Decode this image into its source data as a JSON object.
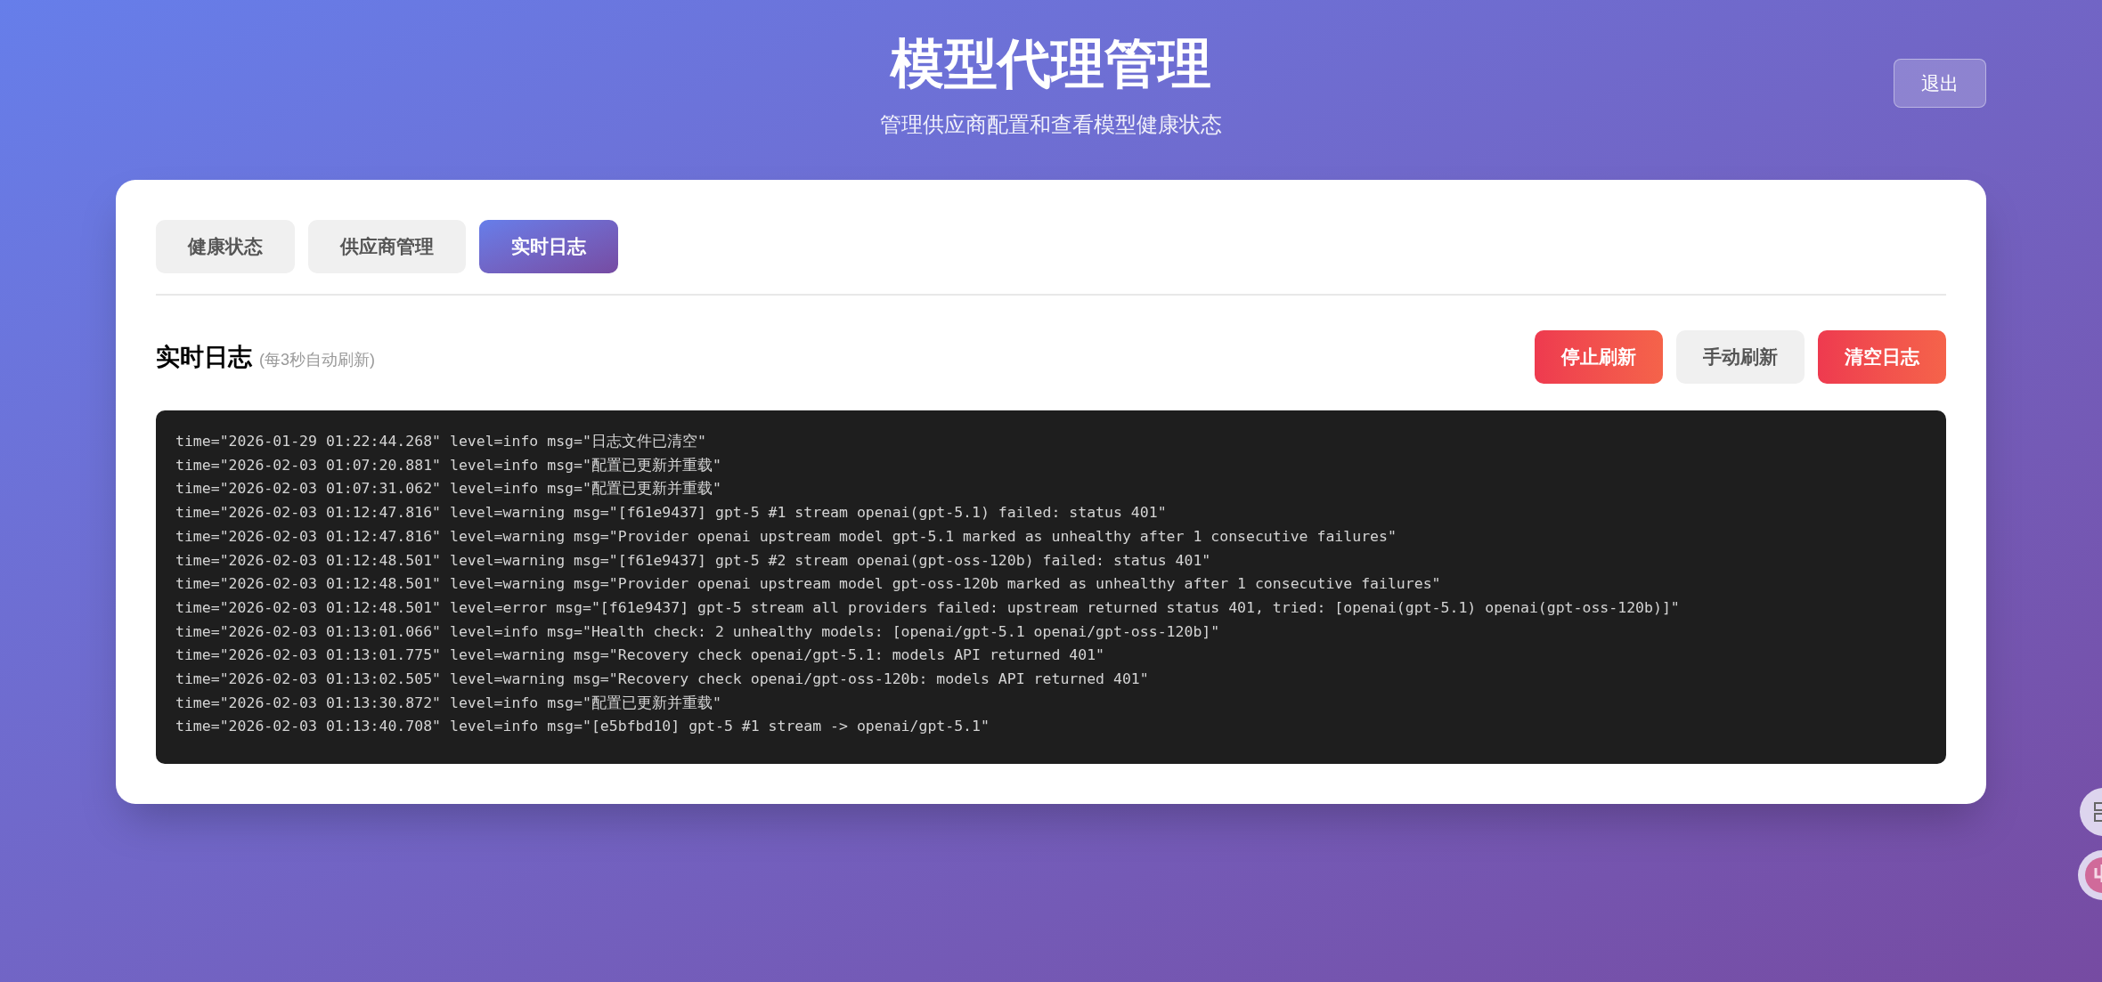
{
  "header": {
    "title": "模型代理管理",
    "subtitle": "管理供应商配置和查看模型健康状态",
    "logout": "退出"
  },
  "tabs": [
    {
      "label": "健康状态",
      "selected": false
    },
    {
      "label": "供应商管理",
      "selected": false
    },
    {
      "label": "实时日志",
      "selected": true
    }
  ],
  "log_panel": {
    "title": "实时日志",
    "note": "(每3秒自动刷新)",
    "buttons": [
      {
        "label": "停止刷新",
        "kind": "danger"
      },
      {
        "label": "手动刷新",
        "kind": "neutral"
      },
      {
        "label": "清空日志",
        "kind": "danger"
      }
    ],
    "lines": [
      "time=\"2026-01-29 01:22:44.268\" level=info msg=\"日志文件已清空\"",
      "time=\"2026-02-03 01:07:20.881\" level=info msg=\"配置已更新并重载\"",
      "time=\"2026-02-03 01:07:31.062\" level=info msg=\"配置已更新并重载\"",
      "time=\"2026-02-03 01:12:47.816\" level=warning msg=\"[f61e9437] gpt-5 #1 stream openai(gpt-5.1) failed: status 401\"",
      "time=\"2026-02-03 01:12:47.816\" level=warning msg=\"Provider openai upstream model gpt-5.1 marked as unhealthy after 1 consecutive failures\"",
      "time=\"2026-02-03 01:12:48.501\" level=warning msg=\"[f61e9437] gpt-5 #2 stream openai(gpt-oss-120b) failed: status 401\"",
      "time=\"2026-02-03 01:12:48.501\" level=warning msg=\"Provider openai upstream model gpt-oss-120b marked as unhealthy after 1 consecutive failures\"",
      "time=\"2026-02-03 01:12:48.501\" level=error msg=\"[f61e9437] gpt-5 stream all providers failed: upstream returned status 401, tried: [openai(gpt-5.1) openai(gpt-oss-120b)]\"",
      "time=\"2026-02-03 01:13:01.066\" level=info msg=\"Health check: 2 unhealthy models: [openai/gpt-5.1 openai/gpt-oss-120b]\"",
      "time=\"2026-02-03 01:13:01.775\" level=warning msg=\"Recovery check openai/gpt-5.1: models API returned 401\"",
      "time=\"2026-02-03 01:13:02.505\" level=warning msg=\"Recovery check openai/gpt-oss-120b: models API returned 401\"",
      "time=\"2026-02-03 01:13:30.872\" level=info msg=\"配置已更新并重载\"",
      "time=\"2026-02-03 01:13:40.708\" level=info msg=\"[e5bfbd10] gpt-5 #1 stream -> openai/gpt-5.1\""
    ]
  }
}
